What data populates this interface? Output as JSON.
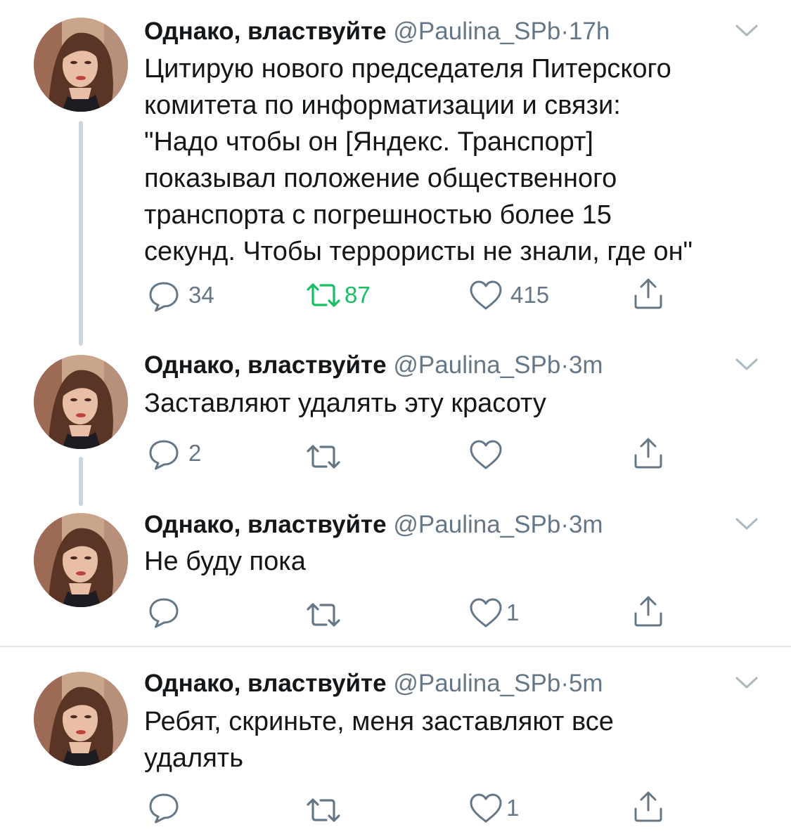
{
  "accent": "#17bf63",
  "muted_color": "#657786",
  "icons": {
    "reply": "speech-bubble",
    "retweet": "retweet-arrows",
    "like": "heart",
    "share": "share-arrow-up",
    "menu": "chevron-down"
  },
  "tweets": [
    {
      "name": "Однако, властвуйте",
      "handle": "@Paulina_SPb",
      "separator": "·",
      "time": "17h",
      "text": "Цитирую нового председателя Питерского\nкомитета по информатизации и связи:\n\"Надо чтобы он [Яндекс. Транспорт]\nпоказывал положение общественного\nтранспорта с погрешностью более 15\nсекунд. Чтобы террористы не знали, где он\"",
      "replies": "34",
      "retweets": "87",
      "retweeted": true,
      "likes": "415"
    },
    {
      "name": "Однако, властвуйте",
      "handle": "@Paulina_SPb",
      "separator": "·",
      "time": "3m",
      "text": "Заставляют удалять эту красоту",
      "replies": "2",
      "retweets": "",
      "retweeted": false,
      "likes": ""
    },
    {
      "name": "Однако, властвуйте",
      "handle": "@Paulina_SPb",
      "separator": "·",
      "time": "3m",
      "text": "Не буду пока",
      "replies": "",
      "retweets": "",
      "retweeted": false,
      "likes": "1"
    },
    {
      "name": "Однако, властвуйте",
      "handle": "@Paulina_SPb",
      "separator": "·",
      "time": "5m",
      "text": "Ребят, скриньте, меня заставляют все\nудалять",
      "replies": "",
      "retweets": "",
      "retweeted": false,
      "likes": "1"
    }
  ]
}
